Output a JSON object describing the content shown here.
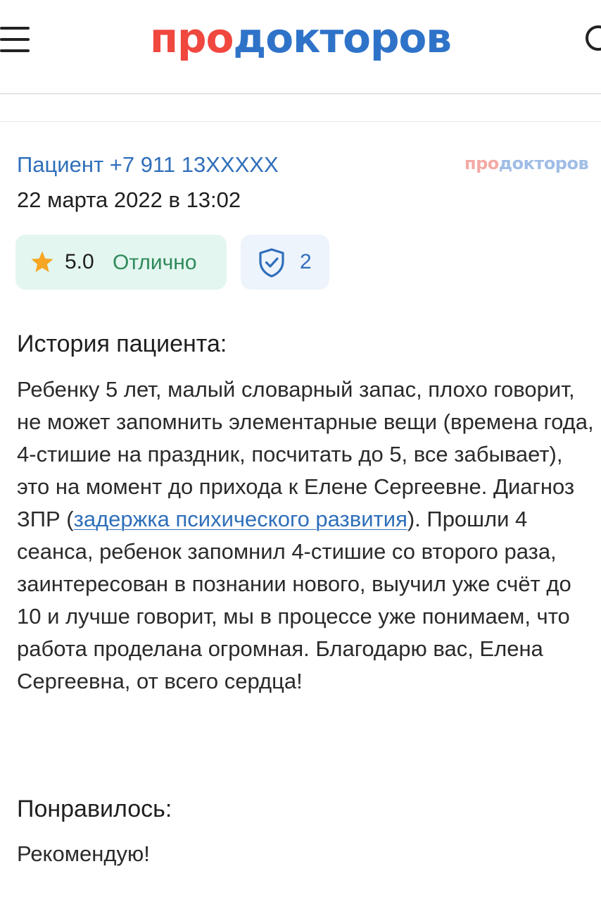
{
  "header": {
    "logo_part_red": "про",
    "logo_part_blue": "докторов",
    "menu_icon": "hamburger-menu-icon",
    "search_icon": "search-icon"
  },
  "review": {
    "author": "Пациент +7 911 13XXXXX",
    "date": "22 марта 2022 в 13:02",
    "watermark_red": "про",
    "watermark_blue": "докторов",
    "rating": {
      "icon": "star-icon",
      "value": "5.0",
      "label": "Отлично"
    },
    "verification": {
      "icon": "shield-check-icon",
      "count": "2"
    },
    "story": {
      "title": "История пациента:",
      "text_before_link": "Ребенку 5 лет, малый словарный запас, плохо говорит, не может запомнить элементарные вещи (времена года, 4-стишие на праздник, посчитать до 5, все забывает), это на момент до прихода к Елене Сергеевне. Диагноз ЗПР (",
      "link_text": "задержка психического развития",
      "text_after_link": "). Прошли 4 сеанса, ребенок запомнил 4-стишие со второго раза, заинтересован в познании нового, выучил уже счёт до 10 и лучше говорит, мы в процессе уже понимаем, что работа проделана огромная. Благодарю вас, Елена Сергеевна, от всего сердца!"
    },
    "liked": {
      "title": "Понравилось:",
      "text": "Рекомендую!"
    }
  },
  "colors": {
    "logo_red": "#f0473f",
    "logo_blue": "#2f73c9",
    "link_blue": "#2f6fba",
    "rating_bg": "#e3f6ef",
    "rating_text": "#2e8a5b",
    "star": "#f6a623",
    "verify_bg": "#eef4fc"
  }
}
